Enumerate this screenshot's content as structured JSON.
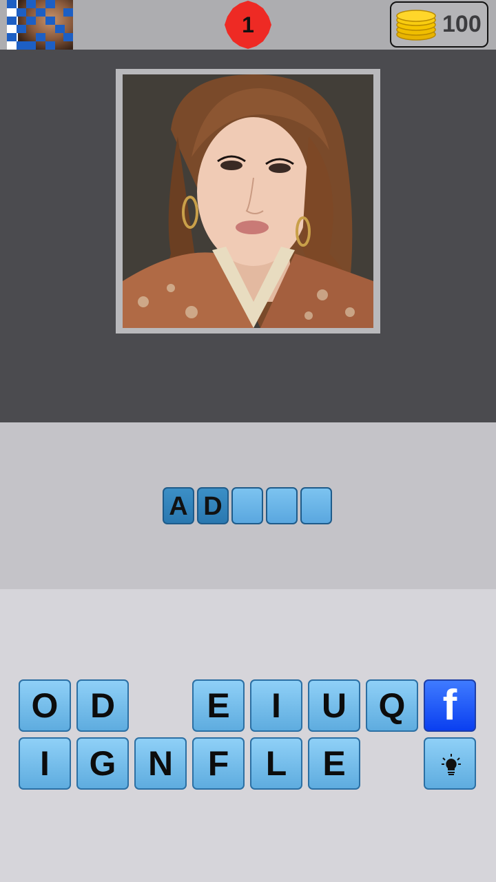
{
  "top_bar": {
    "level": "1",
    "coins": "100",
    "level_badge_color": "#ee2a24",
    "coin_color": "#f5c400"
  },
  "answer": {
    "slots": [
      "A",
      "D",
      "",
      "",
      ""
    ]
  },
  "keyboard": {
    "row1": [
      "O",
      "D",
      "",
      "E",
      "I",
      "U",
      "Q"
    ],
    "row2": [
      "I",
      "G",
      "N",
      "F",
      "L",
      "E"
    ],
    "facebook_label": "f",
    "hint_icon": "lightbulb-icon"
  }
}
